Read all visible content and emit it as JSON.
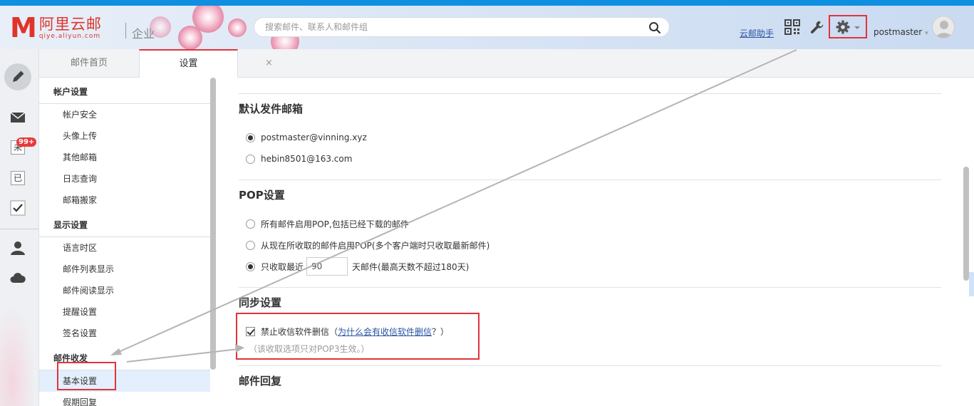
{
  "header": {
    "logo_mark": "M",
    "logo_cn": "阿里云邮",
    "logo_en": "qiye.aliyun.com",
    "logo_sub": "企业",
    "search_placeholder": "搜索邮件、联系人和邮件组",
    "assistant_link": "云邮助手",
    "username": "postmaster"
  },
  "rail": {
    "badge": "99+"
  },
  "tabs": [
    {
      "label": "邮件首页",
      "active": false
    },
    {
      "label": "设置",
      "active": true
    }
  ],
  "tab_close": "×",
  "settings_nav": {
    "sections": [
      {
        "title": "帐户设置",
        "items": [
          "帐户安全",
          "头像上传",
          "其他邮箱",
          "日志查询",
          "邮箱搬家"
        ]
      },
      {
        "title": "显示设置",
        "items": [
          "语言时区",
          "邮件列表显示",
          "邮件阅读显示",
          "提醒设置",
          "签名设置"
        ]
      },
      {
        "title": "邮件收发",
        "items": [
          "基本设置",
          "假期回复"
        ]
      }
    ],
    "selected": "基本设置"
  },
  "content": {
    "default_sender": {
      "title": "默认发件邮箱",
      "options": [
        {
          "label": "postmaster@vinning.xyz",
          "checked": true
        },
        {
          "label": "hebin8501@163.com",
          "checked": false
        }
      ]
    },
    "pop": {
      "title": "POP设置",
      "option_all": "所有邮件启用POP,包括已经下载的邮件",
      "option_now": "从现在所收取的邮件启用POP(多个客户端时只收取最新邮件)",
      "option_recent_prefix": "只收取最近",
      "days_value": "90",
      "option_recent_suffix": "天邮件(最高天数不超过180天)",
      "selected": "recent"
    },
    "sync": {
      "title": "同步设置",
      "checkbox_label": "禁止收信软件删信（",
      "why_link": "为什么会有收信软件删信",
      "checkbox_tail": "？）",
      "checked": true,
      "hint": "（该收取选项只对POP3生效。）"
    },
    "reply": {
      "title": "邮件回复"
    }
  },
  "colors": {
    "accent_red": "#e0343a",
    "link_blue": "#2a55a0",
    "top_strip": "#0f8fe0",
    "selected_bg": "#e3effd"
  }
}
